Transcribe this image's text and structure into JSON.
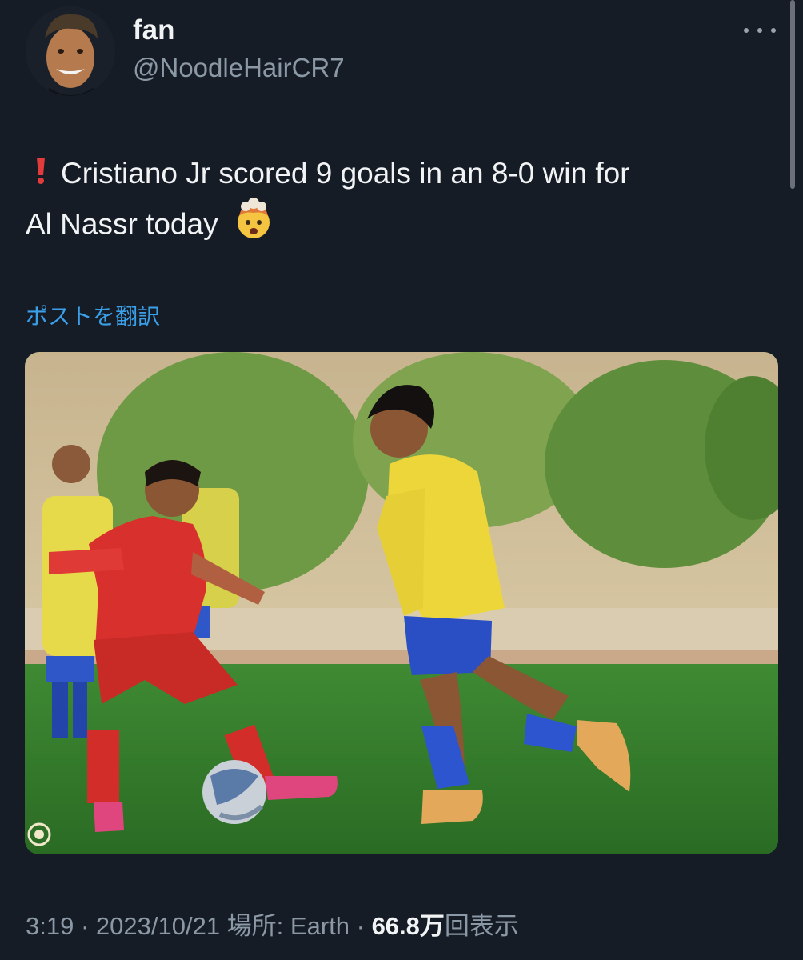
{
  "tweet": {
    "author": {
      "display_name": "fan",
      "handle": "@NoodleHairCR7"
    },
    "text_line1": "Cristiano Jr scored 9 goals in an 8-0 win for",
    "text_line2": "Al Nassr today",
    "translate_label": "ポストを翻訳",
    "meta": {
      "time": "3:19",
      "sep1": " · ",
      "date": "2023/10/21",
      "location": " 場所: Earth",
      "sep2": " · ",
      "views_count": "66.8万",
      "views_label": "回表示"
    }
  },
  "colors": {
    "background": "#151c26",
    "link": "#3aa0ea",
    "secondary_text": "#8b98a5"
  },
  "icons": [
    "more-icon",
    "exclamation-icon",
    "exploding-head-emoji"
  ]
}
